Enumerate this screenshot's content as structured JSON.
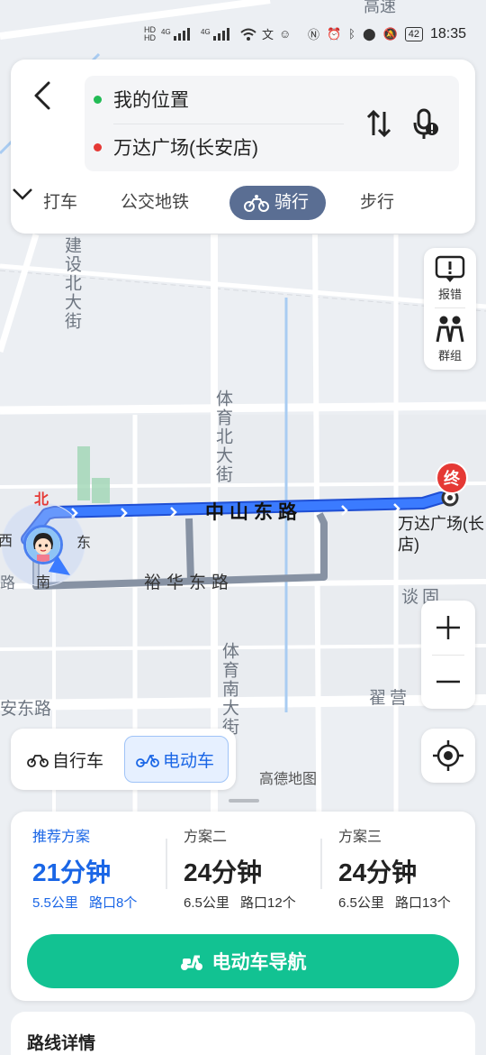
{
  "status_bar": {
    "left_icons": [
      "HD",
      "4G",
      "signal",
      "4G",
      "signal",
      "wifi",
      "translate-icon",
      "chat-icon"
    ],
    "right_icons": [
      "nfc-icon",
      "alarm-icon",
      "bluetooth-icon",
      "location-icon",
      "mute-icon"
    ],
    "battery": "42",
    "time": "18:35"
  },
  "route": {
    "origin": "我的位置",
    "destination": "万达广场(长安店)",
    "origin_color": "#22bb55",
    "destination_color": "#e53935"
  },
  "modes": {
    "taxi": "打车",
    "transit": "公交地铁",
    "bike": "骑行",
    "walk": "步行",
    "active": "bike"
  },
  "side_tools": {
    "report": "报错",
    "group": "群组"
  },
  "map": {
    "roads": {
      "jianshe_north": "建设北大街",
      "tiyu_north": "体育北大街",
      "zhongshan_east": "中山东路",
      "yuhua_east": "裕华东路",
      "tiyu_south": "体育南大街",
      "anan_east": "安东路",
      "zhaiying": "翟营",
      "tanggu_fragment": "谈固",
      "highway_fragment": "高速"
    },
    "compass": {
      "north": "北",
      "west": "西",
      "east": "东",
      "south": "南",
      "south_fragment": "路"
    },
    "end_badge": "终",
    "destination_label_line1": "万达广场(长",
    "destination_label_line2": "店)",
    "route_color": "#2f6bff",
    "logo": "高德地图"
  },
  "vehicle": {
    "bicycle": "自行车",
    "ebike": "电动车",
    "active": "ebike"
  },
  "plans": [
    {
      "name": "推荐方案",
      "time": "21分钟",
      "distance": "5.5公里",
      "intersections": "路口8个"
    },
    {
      "name": "方案二",
      "time": "24分钟",
      "distance": "6.5公里",
      "intersections": "路口12个"
    },
    {
      "name": "方案三",
      "time": "24分钟",
      "distance": "6.5公里",
      "intersections": "路口13个"
    }
  ],
  "nav_button": "电动车导航",
  "details_title": "路线详情"
}
